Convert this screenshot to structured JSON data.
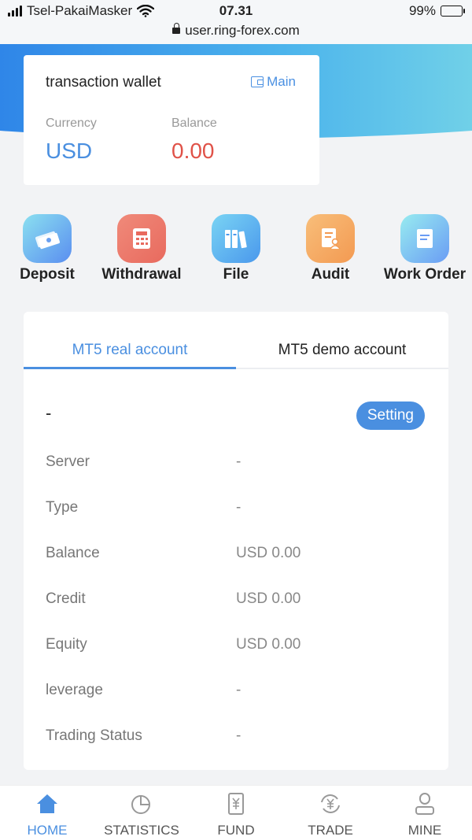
{
  "status_bar": {
    "carrier": "Tsel-PakaiMasker",
    "time": "07.31",
    "battery": "99%",
    "url": "user.ring-forex.com"
  },
  "wallet": {
    "title": "transaction wallet",
    "main_link": "Main",
    "currency_label": "Currency",
    "balance_label": "Balance",
    "currency_value": "USD",
    "balance_value": "0.00",
    "currency_color": "#4a8fe0",
    "balance_color": "#e05248"
  },
  "actions": [
    {
      "label": "Deposit",
      "icon": "money-icon"
    },
    {
      "label": "Withdrawal",
      "icon": "calculator-icon"
    },
    {
      "label": "File",
      "icon": "folders-icon"
    },
    {
      "label": "Audit",
      "icon": "document-person-icon"
    },
    {
      "label": "Work Order",
      "icon": "document-icon"
    }
  ],
  "account": {
    "tabs": [
      {
        "label": "MT5 real account",
        "active": true
      },
      {
        "label": "MT5 demo account",
        "active": false
      }
    ],
    "name": "-",
    "setting_button": "Setting",
    "rows": [
      {
        "key": "Server",
        "value": "-"
      },
      {
        "key": "Type",
        "value": "-"
      },
      {
        "key": "Balance",
        "value": "USD 0.00"
      },
      {
        "key": "Credit",
        "value": "USD 0.00"
      },
      {
        "key": "Equity",
        "value": "USD 0.00"
      },
      {
        "key": "leverage",
        "value": "-"
      },
      {
        "key": "Trading Status",
        "value": "-"
      }
    ]
  },
  "bottom_nav": [
    {
      "label": "HOME",
      "icon": "home-icon",
      "active": true
    },
    {
      "label": "STATISTICS",
      "icon": "pie-chart-icon",
      "active": false
    },
    {
      "label": "FUND",
      "icon": "yen-document-icon",
      "active": false
    },
    {
      "label": "TRADE",
      "icon": "yen-exchange-icon",
      "active": false
    },
    {
      "label": "MINE",
      "icon": "user-icon",
      "active": false
    }
  ],
  "colors": {
    "accent": "#4a8fe0",
    "negative": "#e05248"
  }
}
